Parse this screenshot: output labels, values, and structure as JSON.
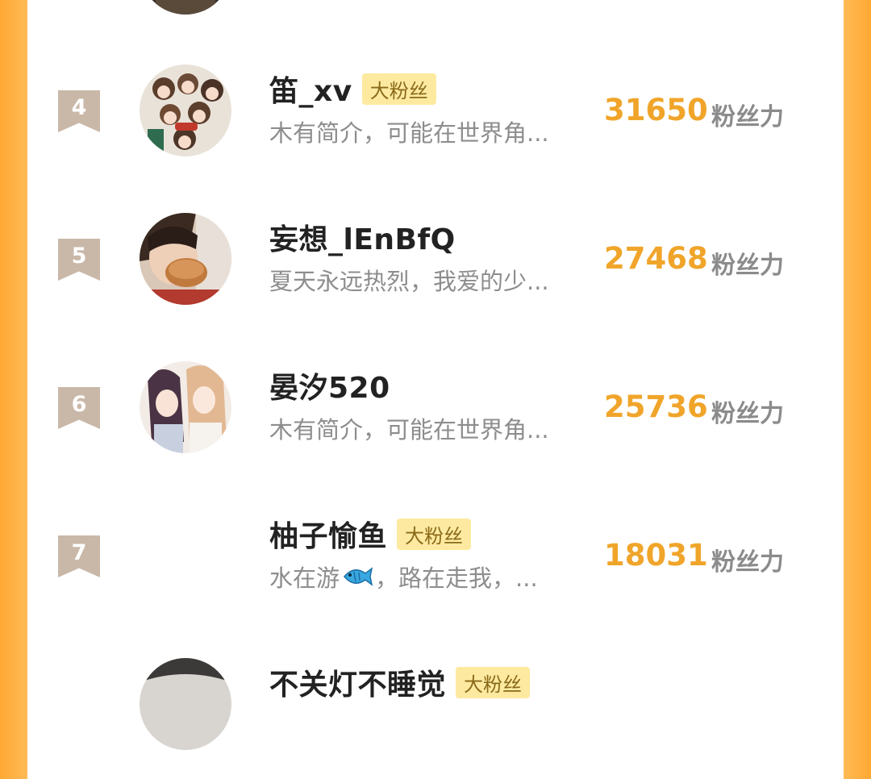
{
  "rows": [
    {
      "rank": "4",
      "name": "笛_xv",
      "badge": "大粉丝",
      "bio": "木有简介，可能在世界角...",
      "score": "31650",
      "score_unit": "粉丝力"
    },
    {
      "rank": "5",
      "name": "妄想_lEnBfQ",
      "badge": "",
      "bio": "夏天永远热烈，我爱的少...",
      "score": "27468",
      "score_unit": "粉丝力"
    },
    {
      "rank": "6",
      "name": "晏汐520",
      "badge": "",
      "bio": "木有简介，可能在世界角...",
      "score": "25736",
      "score_unit": "粉丝力"
    },
    {
      "rank": "7",
      "name": "柚子愉鱼",
      "badge": "大粉丝",
      "bio_prefix": "水在游",
      "bio_suffix": "，路在走我，...",
      "score": "18031",
      "score_unit": "粉丝力"
    },
    {
      "rank": "",
      "name": "不关灯不睡觉",
      "badge": "大粉丝",
      "bio": "",
      "score": "",
      "score_unit": ""
    }
  ],
  "colors": {
    "accent": "#f0a52a",
    "frame": "#ffa834",
    "rank_flag": "#c9b8a8",
    "badge_bg": "#fdeaa0"
  },
  "icons": {
    "fish": "fish-emoji-icon"
  }
}
